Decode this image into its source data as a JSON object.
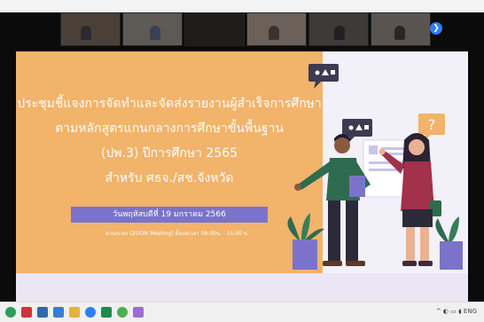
{
  "window": {
    "title": ""
  },
  "participants": [
    {
      "name": ""
    },
    {
      "name": ""
    },
    {
      "name": ""
    },
    {
      "name": ""
    },
    {
      "name": ""
    },
    {
      "name": ""
    }
  ],
  "slide": {
    "title_line1": "ประชุมชี้แจงการจัดทำและจัดส่งรายงานผู้สำเร็จการศึกษา",
    "title_line2": "ตามหลักสูตรแกนกลางการศึกษาขั้นพื้นฐาน",
    "title_line3": "(ปพ.3) ปีการศึกษา 2565",
    "title_line4": "สำหรับ ศธจ./สช.จังหวัด",
    "date": "วันพฤหัสบดีที่ 19 มกราคม 2566",
    "meeting_note": "ผ่านระบบ (ZOOM Meeting) ตั้งแต่เวลา 09.00น. - 15.00 น.",
    "bubble_question": "?"
  },
  "tray": {
    "lang": "ENG"
  },
  "colors": {
    "panel": "#f2b36a",
    "date_bar": "#7b73c9",
    "zoom_bg": "#0b0b0b",
    "accent": "#2d7ff9"
  }
}
